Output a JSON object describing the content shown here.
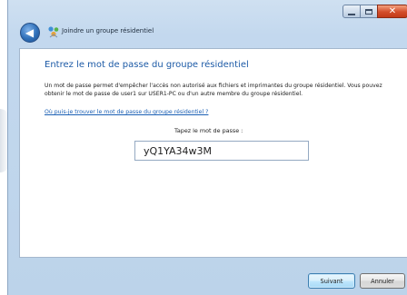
{
  "window": {
    "title": "Joindre un groupe résidentiel",
    "caption_close": "✕"
  },
  "main": {
    "heading": "Entrez le mot de passe du groupe résidentiel",
    "description": "Un mot de passe permet d'empêcher l'accès non autorisé aux fichiers et imprimantes du groupe résidentiel. Vous pouvez obtenir le mot de passe de user1 sur USER1-PC ou d'un autre membre du groupe résidentiel.",
    "help_link": "Où puis-je trouver le mot de passe du groupe résidentiel ?",
    "password_label": "Tapez le mot de passe :",
    "password_value": "yQ1YA34w3M"
  },
  "footer": {
    "next_label": "Suivant",
    "cancel_label": "Annuler"
  },
  "colors": {
    "heading": "#1c5aa6",
    "link": "#1a5fb4",
    "titlebar": "#c3d8ee",
    "close_button": "#d34d2a"
  },
  "icons": {
    "back": "back-arrow-icon",
    "title": "homegroup-icon",
    "minimize": "minimize-icon",
    "maximize": "maximize-icon",
    "close": "close-icon"
  }
}
